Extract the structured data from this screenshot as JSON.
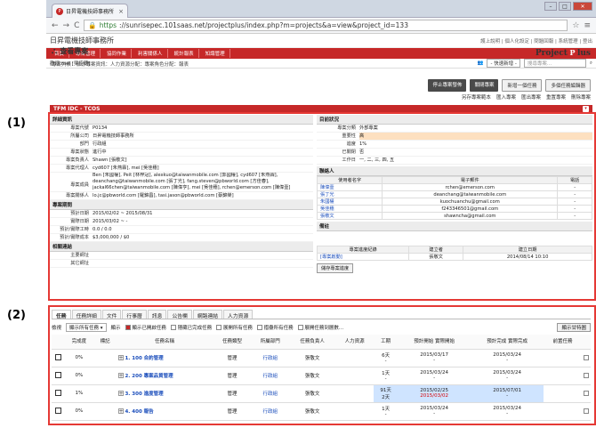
{
  "browser": {
    "tab_title": "日昇電機技師事務所",
    "url_scheme": "https",
    "url_rest": "://sunrisepec.101saas.net/projectplus/index.php?m=projects&a=view&project_id=133"
  },
  "site": {
    "name": "日昇電機技師事務所",
    "toplinks": "護上說明 | 個人化設定 | 問題回報 | 系統管理 | 登出",
    "logo": "Project",
    "logo_badge": "P",
    "menu": [
      "首頁",
      "專案管理",
      "協同作業",
      "利害關係人",
      "統計報表",
      "知識管理"
    ],
    "welcome": "歡迎 mei [吳佳穗]",
    "quick_add": "- 快速新增 -",
    "search_placeholder": "搜尋專案..."
  },
  "page": {
    "title": "查看專案",
    "breadcrumb": "專案列表：郁亦專案資訊：人力資源分配：專案角色分配：報表",
    "buttons": [
      "停止專案發佈",
      "關閉專案",
      "新增一個任務",
      "多個任務編輯器"
    ],
    "actions": [
      "另存專案範本",
      "匯入專案",
      "匯出專案",
      "重置專案",
      "刪除專案"
    ],
    "panel_title": "TFM IDC - TCOS"
  },
  "annotations": {
    "one": "(1)",
    "two": "(2)"
  },
  "details": {
    "section": "詳細資訊",
    "rows": [
      {
        "k": "專案代號",
        "v": "P0134"
      },
      {
        "k": "所屬公司",
        "v": "日昇電機技師事務所",
        "link": true
      },
      {
        "k": "部門",
        "v": "行政組",
        "link": true
      },
      {
        "k": "專案狀態",
        "v": "進行中"
      },
      {
        "k": "專案負責人",
        "v": "Shawn [張敬文]"
      },
      {
        "k": "專案代理人",
        "v": "cyd607 [朱燕霖], mei [吳佳穗]"
      },
      {
        "k": "專案成員",
        "v": "Ben [朱國權], Peit [林梓冠], alexkuo@taiwanmobile.com [郭國權], cyd607 [朱燕霖], deanchang@taiwanmobile.com [張丁光], fang.steven@pbworld.com [方佳春], jackal66chen@taiwanmobile.com [陳偉亨], mei [吳佳穗], rchen@emerson.com [陳偉壹]"
      },
      {
        "k": "專案關係人",
        "v": "lo.jc@pbworld.com [羅錦昌], tasi.jason@pbworld.com [蔡錦榮]"
      }
    ],
    "time_section": "專案期間",
    "time_rows": [
      {
        "k": "預計日期",
        "v": "2015/02/02 ~ 2015/08/31"
      },
      {
        "k": "實際日期",
        "v": "2015/03/02 ~ -"
      },
      {
        "k": "預計/實際工時",
        "v": "0.0 / 0.0"
      },
      {
        "k": "預計/實際成本",
        "v": "$3,000,000 / $0"
      }
    ],
    "link_section": "相關連結",
    "link_rows": [
      {
        "k": "主要網址",
        "v": ""
      },
      {
        "k": "其它網址",
        "v": ""
      }
    ]
  },
  "status": {
    "section": "目前狀況",
    "rows": [
      {
        "k": "專案分類",
        "v": "外部專案"
      },
      {
        "k": "重要性",
        "v": "高"
      },
      {
        "k": "進度",
        "v": "1%"
      },
      {
        "k": "已關閉",
        "v": "否"
      },
      {
        "k": "工作日",
        "v": "一, 二, 三, 四, 五"
      }
    ],
    "contacts_section": "聯絡人",
    "contact_headers": [
      "使用者名字",
      "電子郵件",
      "電話"
    ],
    "contacts": [
      {
        "name": "陳偉壹",
        "email": "rchen@emerson.com",
        "phone": "-"
      },
      {
        "name": "張丁光",
        "email": "deanchang@taiwanmobile.com",
        "phone": "-"
      },
      {
        "name": "朱國權",
        "email": "kuochuanchu@gmail.com",
        "phone": "-"
      },
      {
        "name": "吳佳穗",
        "email": "f243346501@gmail.com",
        "phone": "-"
      },
      {
        "name": "張敬文",
        "email": "shawncha@gmail.com",
        "phone": "-"
      }
    ],
    "notes_section": "備註",
    "progress_headers": [
      "專案進度紀錄",
      "建立者",
      "建立日期"
    ],
    "progress": [
      {
        "record": "[專案啟動]",
        "by": "張敬文",
        "date": "2014/08/14 10:10"
      }
    ],
    "save_label": "儲存專案進度"
  },
  "tasks": {
    "tabs": [
      "任務",
      "任務詳細",
      "文件",
      "行事曆",
      "訊息",
      "公告欄",
      "網路連結",
      "人力資源"
    ],
    "filter": {
      "label": "檢視",
      "value": "顯示所有任務",
      "show_label": "顯示",
      "options": [
        "顯示已開啟任務",
        "隱藏已完成任務",
        "展開所有任務",
        "摺疊所有任務",
        "展開任務到層數..."
      ],
      "show_all": "顯示甘特圖"
    },
    "headers": [
      "完成度",
      "標記",
      "任務名稱",
      "任務類型",
      "所屬部門",
      "任務負責人",
      "人力資源",
      "工期",
      "預計開始\n實際開始",
      "預計完成\n實際完成",
      "前置任務"
    ],
    "rows": [
      {
        "done": "0%",
        "name": "1. 100 合約管理",
        "type": "管理",
        "dept": "行政組",
        "owner": "張敬文",
        "dur": "6天",
        "dur2": "-",
        "ps": "2015/03/17",
        "as": "-",
        "pe": "2015/03/24",
        "ae": "-",
        "hi": false
      },
      {
        "done": "0%",
        "name": "2. 200 專案品質管理",
        "type": "管理",
        "dept": "行政組",
        "owner": "張敬文",
        "dur": "1天",
        "dur2": "-",
        "ps": "2015/03/24",
        "as": "-",
        "pe": "2015/03/24",
        "ae": "-",
        "hi": false
      },
      {
        "done": "1%",
        "name": "3. 300 進度管理",
        "type": "管理",
        "dept": "行政組",
        "owner": "張敬文",
        "dur": "91天",
        "dur2": "2天",
        "ps": "2015/02/25",
        "as": "2015/03/02",
        "pe": "2015/07/01",
        "ae": "-",
        "hi": true
      },
      {
        "done": "0%",
        "name": "4. 400 報告",
        "type": "管理",
        "dept": "行政組",
        "owner": "張敬文",
        "dur": "1天",
        "dur2": "-",
        "ps": "2015/03/24",
        "as": "-",
        "pe": "2015/03/24",
        "ae": "-",
        "hi": false
      }
    ]
  }
}
